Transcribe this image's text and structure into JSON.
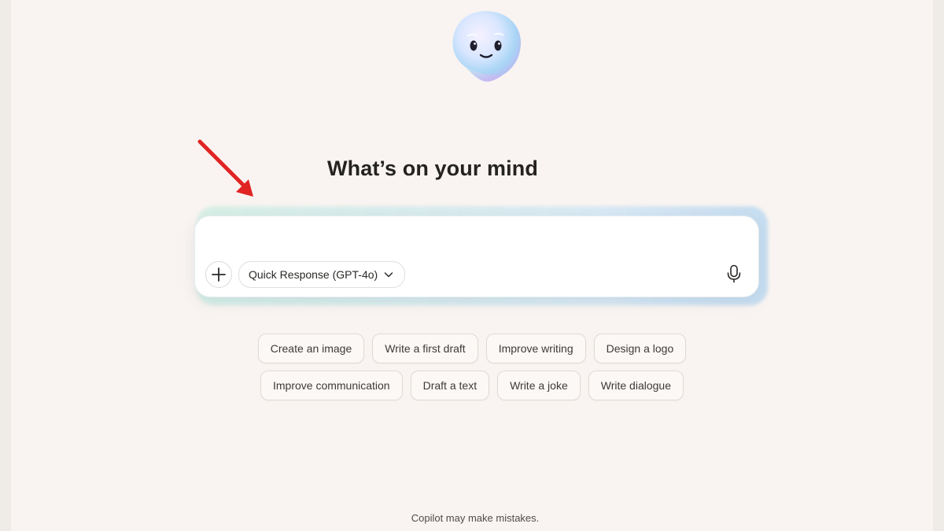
{
  "heading": "What’s on your mind",
  "composer": {
    "value": "",
    "placeholder": "",
    "model_label": "Quick Response (GPT-4o)",
    "icons": {
      "add": "plus-icon",
      "dropdown": "chevron-down-icon",
      "voice": "microphone-icon"
    }
  },
  "suggestions": {
    "row1": [
      "Create an image",
      "Write a first draft",
      "Improve writing",
      "Design a logo"
    ],
    "row2": [
      "Improve communication",
      "Draft a text",
      "Write a joke",
      "Write dialogue"
    ]
  },
  "footer": "Copilot may make mistakes.",
  "colors": {
    "background": "#f9f4f1",
    "annotation_arrow": "#e02424",
    "text": "#252321"
  }
}
